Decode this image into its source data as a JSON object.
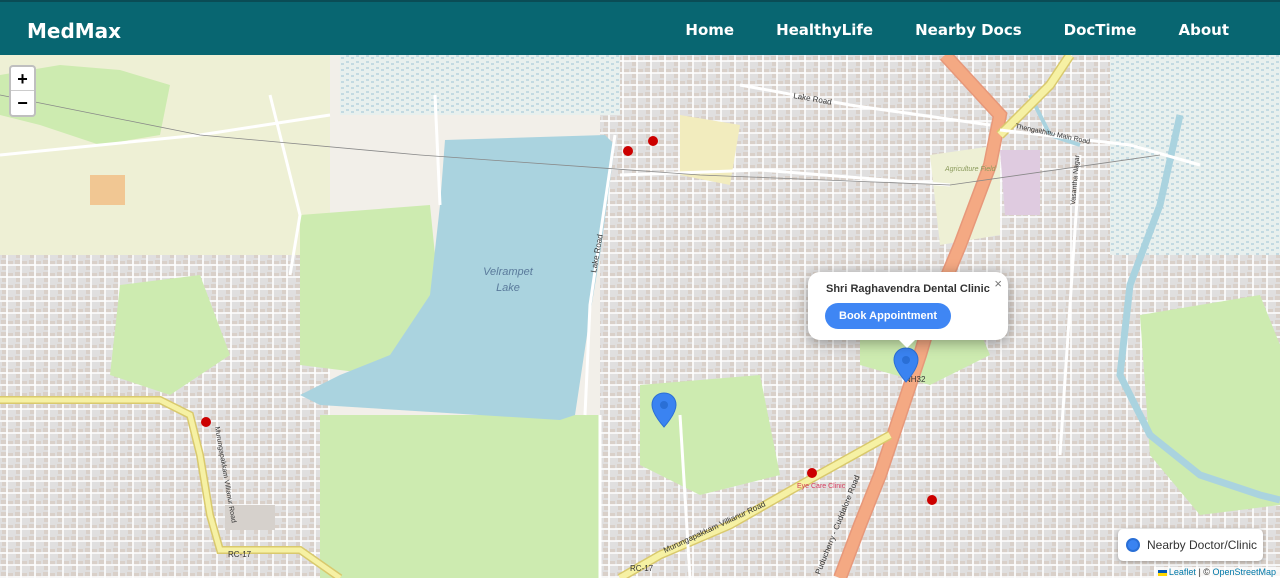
{
  "navbar": {
    "brand": "MedMax",
    "links": [
      "Home",
      "HealthyLife",
      "Nearby Docs",
      "DocTime",
      "About"
    ]
  },
  "map": {
    "zoom_in": "+",
    "zoom_out": "−",
    "lake_label_line1": "Velrampet",
    "lake_label_line2": "Lake",
    "road_labels": [
      "Lake Road",
      "Lake Road",
      "Thengaithittu Main Road",
      "Vasantha Nagar",
      "Murungapakkam Villianur Road",
      "Puducherry - Cuddalore Road",
      "Murungapakkam Villianur Road",
      "NH32",
      "RC-17",
      "RC-17",
      "Agriculture Field",
      "Eye Care Clinic"
    ],
    "popup": {
      "title": "Shri Raghavendra Dental Clinic",
      "button": "Book Appointment",
      "close": "×"
    },
    "legend": {
      "label": "Nearby Doctor/Clinic"
    },
    "attribution": {
      "leaflet": "Leaflet",
      "separator": "| ©",
      "osm": "OpenStreetMap"
    }
  },
  "colors": {
    "navbar": "#086671",
    "button": "#3f86f4",
    "marker": "#3a83f1",
    "lake": "#aad3df",
    "park": "#cdebb0",
    "trunk_road": "#f4a983"
  }
}
